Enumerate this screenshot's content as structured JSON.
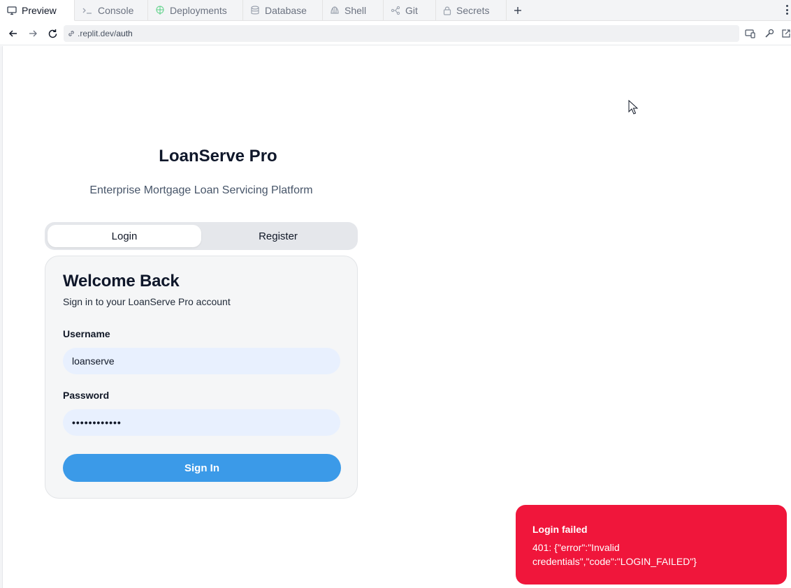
{
  "tabs": [
    {
      "label": "Preview",
      "icon": "monitor-icon",
      "active": true
    },
    {
      "label": "Console",
      "icon": "terminal-icon",
      "active": false
    },
    {
      "label": "Deployments",
      "icon": "deployments-icon",
      "active": false
    },
    {
      "label": "Database",
      "icon": "database-icon",
      "active": false
    },
    {
      "label": "Shell",
      "icon": "shell-icon",
      "active": false
    },
    {
      "label": "Git",
      "icon": "git-icon",
      "active": false
    },
    {
      "label": "Secrets",
      "icon": "lock-icon",
      "active": false
    }
  ],
  "address": {
    "url_prefix": ".replit.dev/",
    "url_path": "auth"
  },
  "app": {
    "title": "LoanServe Pro",
    "subtitle": "Enterprise Mortgage Loan Servicing Platform"
  },
  "auth_tabs": {
    "login": "Login",
    "register": "Register",
    "active": "Login"
  },
  "login_card": {
    "title": "Welcome Back",
    "description": "Sign in to your LoanServe Pro account",
    "username_label": "Username",
    "username_value": "loanserve",
    "password_label": "Password",
    "password_mask": "••••••••••••",
    "submit_label": "Sign In"
  },
  "toast": {
    "title": "Login failed",
    "message": "401: {\"error\":\"Invalid credentials\",\"code\":\"LOGIN_FAILED\"}"
  },
  "colors": {
    "primary_button": "#3b9ae8",
    "toast_error": "#f0163b",
    "input_background": "#e8f0fe"
  }
}
